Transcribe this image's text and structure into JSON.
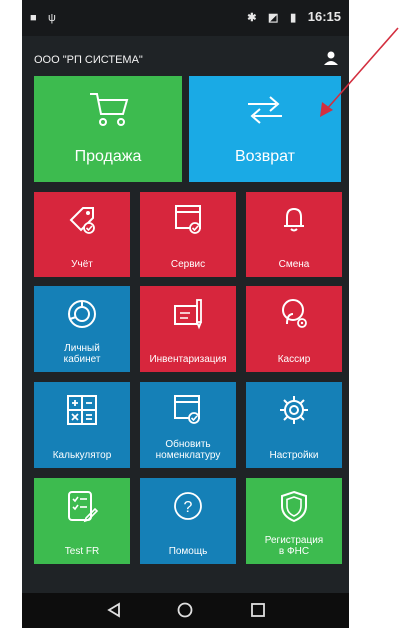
{
  "status_bar": {
    "time": "16:15"
  },
  "header": {
    "company": "ООО \"РП СИСТЕМА\""
  },
  "tiles": {
    "sale": "Продажа",
    "return": "Возврат",
    "accounting": "Учёт",
    "service": "Сервис",
    "shift": "Смена",
    "cabinet": "Личный\nкабинет",
    "inventory": "Инвентаризация",
    "cashier": "Кассир",
    "calculator": "Калькулятор",
    "update": "Обновить\nноменклатуру",
    "settings": "Настройки",
    "test": "Test FR",
    "help": "Помощь",
    "registration": "Регистрация\nв ФНС"
  },
  "colors": {
    "green": "#3dbb4f",
    "blue_light": "#1aaae5",
    "red": "#d7263d",
    "blue": "#1580b7",
    "annotation_arrow": "#d32f3f"
  },
  "icons": {
    "status": [
      "notification-icon",
      "usb-icon",
      "bluetooth-icon",
      "signal-icon",
      "battery-icon"
    ],
    "nav": [
      "back-icon",
      "home-icon",
      "recents-icon"
    ]
  }
}
